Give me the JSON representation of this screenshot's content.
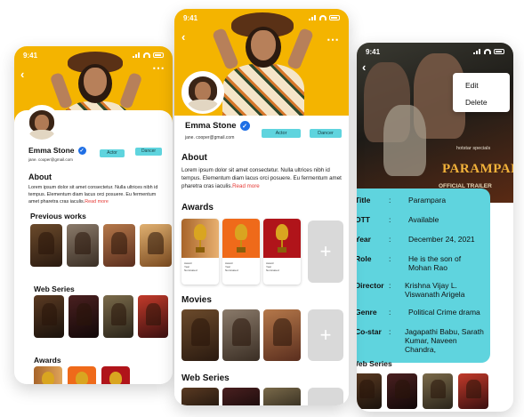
{
  "left": {
    "time": "9:41",
    "name": "Emma Stone",
    "email": "jane. cooper@gmail.com",
    "tags": [
      "Actor",
      "Dancer"
    ],
    "about_heading": "About",
    "about_text": "Lorem ipsum dolor sit amet consectetur. Nulla ultrices nibh id tempus. Elementum diam lacus orci posuere. Eu fermentum amet pharetra cras iaculis.",
    "read_more": "Read more",
    "previous_heading": "Previous works",
    "web_heading": "Web Series",
    "awards_heading": "Awards"
  },
  "center": {
    "time": "9:41",
    "name": "Emma Stone",
    "email": "jane. cooper@gmail.com",
    "tags": [
      "Actor",
      "Dancer"
    ],
    "about_heading": "About",
    "about_text": "Lorem ipsum dolor sit amet consectetur. Nulla ultrices nibh id tempus. Elementum diam lacus orci posuere. Eu fermentum amet pharetra cras iaculis.",
    "read_more": "Read more",
    "awards_heading": "Awards",
    "movies_heading": "Movies",
    "web_heading": "Web Series",
    "add_symbol": "+",
    "award_meta_labels": [
      "Award",
      "Year",
      "Nominated"
    ]
  },
  "right": {
    "time": "9:41",
    "menu": [
      "Edit",
      "Delete"
    ],
    "poster_title": "PARAMPARA",
    "poster_brand": "hotstar specials",
    "poster_subtitle": "OFFICIAL TRAILER",
    "details": [
      {
        "label": "Title",
        "value": "Parampara"
      },
      {
        "label": "OTT",
        "value": "Available"
      },
      {
        "label": "Year",
        "value": "December 24, 2021"
      },
      {
        "label": "Role",
        "value": "He is the son of Mohan Rao"
      },
      {
        "label": "Director",
        "value": "Krishna Vijay L. Viswanath Arigela"
      },
      {
        "label": "Genre",
        "value": "Political Crime drama"
      },
      {
        "label": "Co-star",
        "value": "Jagapathi Babu, Sarath Kumar, Naveen Chandra,"
      }
    ],
    "web_heading": "Web Series"
  },
  "colors": {
    "accent": "#f4b400",
    "tag": "#5fd4de",
    "link": "#e53935",
    "verified": "#1f6fe5"
  }
}
